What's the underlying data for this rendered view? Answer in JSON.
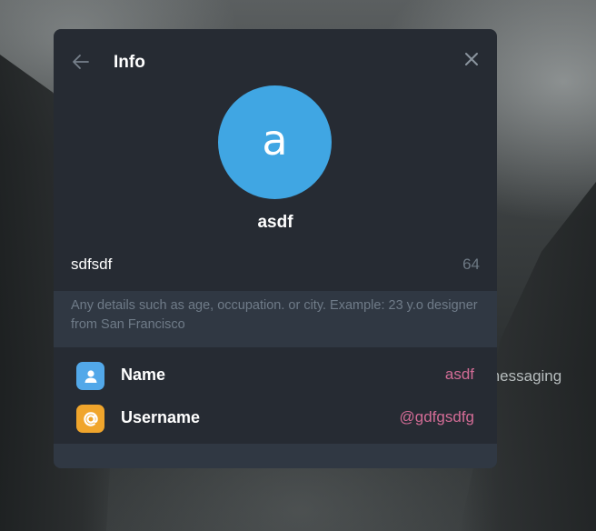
{
  "background": {
    "partial_text": "messaging"
  },
  "dialog": {
    "title": "Info",
    "back_icon": "arrow-left-icon",
    "close_icon": "close-icon",
    "avatar": {
      "letter": "a",
      "color": "#40a6e3"
    },
    "display_name": "asdf",
    "bio": {
      "value": "sdfsdf",
      "remaining_chars": "64",
      "hint": "Any details such as age, occupation. or city. Example: 23 y.o designer from San Francisco"
    },
    "rows": [
      {
        "icon": "person-icon",
        "icon_color": "#52a8e9",
        "label": "Name",
        "value": "asdf"
      },
      {
        "icon": "at-sign-icon",
        "icon_color": "#f0a52c",
        "label": "Username",
        "value": "@gdfgsdfg"
      }
    ],
    "colors": {
      "panel": "#262b33",
      "hint_background": "#303843",
      "accent_value": "#d36c96",
      "muted_text": "#6f7b88"
    }
  }
}
